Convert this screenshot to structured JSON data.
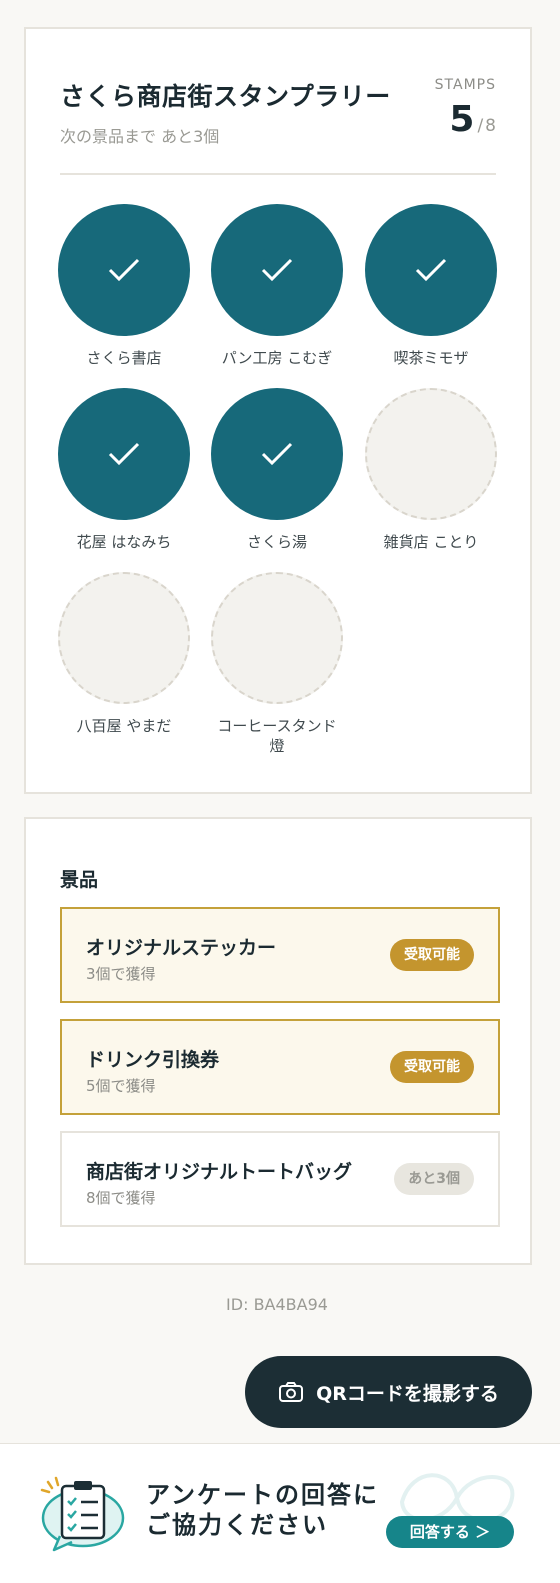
{
  "rally": {
    "title": "さくら商店街スタンプラリー",
    "subtitle": "次の景品まで あと3個",
    "stamps_label": "STAMPS",
    "collected": "5",
    "separator": "/",
    "total": "8"
  },
  "stamps": [
    {
      "name": "さくら書店",
      "collected": true
    },
    {
      "name": "パン工房 こむぎ",
      "collected": true
    },
    {
      "name": "喫茶ミモザ",
      "collected": true
    },
    {
      "name": "花屋 はなみち",
      "collected": true
    },
    {
      "name": "さくら湯",
      "collected": true
    },
    {
      "name": "雑貨店 ことり",
      "collected": false
    },
    {
      "name": "八百屋 やまだ",
      "collected": false
    },
    {
      "name": "コーヒースタンド 燈",
      "collected": false
    }
  ],
  "prizes": {
    "heading": "景品",
    "items": [
      {
        "name": "オリジナルステッカー",
        "condition": "3個で獲得",
        "badge": "受取可能",
        "available": true
      },
      {
        "name": "ドリンク引換券",
        "condition": "5個で獲得",
        "badge": "受取可能",
        "available": true
      },
      {
        "name": "商店街オリジナルトートバッグ",
        "condition": "8個で獲得",
        "badge": "あと3個",
        "available": false
      }
    ]
  },
  "user_id": "ID: BA4BA94",
  "qr_button": {
    "label": "QRコードを撮影する",
    "icon": "camera-icon"
  },
  "banner": {
    "line1": "アンケートの回答に",
    "line2": "ご協力ください",
    "button_label": "回答する ＞",
    "icon": "survey-clipboard-icon"
  },
  "colors": {
    "stamp_done": "#17697a",
    "accent_gold": "#c4952e",
    "dark": "#1c2e35",
    "teal_button": "#16858a"
  }
}
